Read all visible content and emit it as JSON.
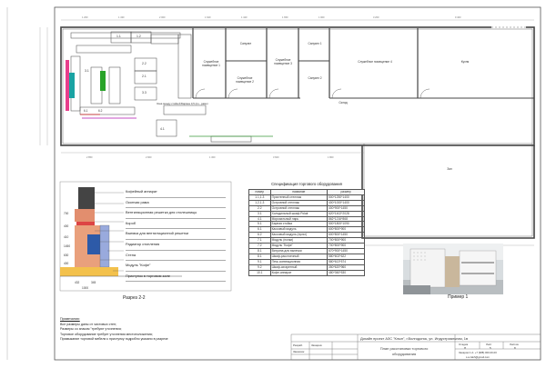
{
  "plan": {
    "rooms": [
      "Служебное помещение 1",
      "Санузел",
      "Служебное помещение 2",
      "Служебное помещение 3",
      "Санузел 1",
      "Санузел 2",
      "Служебное помещение 4",
      "Склад",
      "Кухня",
      "Зал"
    ],
    "labels": {
      "gap_note": "Зона между стойкой Бармен 0,5 (по - раме)",
      "stair": "4.1",
      "c11": "1.1",
      "c12": "1.2",
      "c22": "2.2",
      "c21": "2.1",
      "c33": "3.3",
      "c31": "3.1",
      "c61": "6.1",
      "c62": "6.2"
    }
  },
  "legend": {
    "items": [
      "Кофейный аппарат",
      "Окончая рама",
      "Вентиляционная решетка для столешницы",
      "Короб",
      "Выемка для вентиляционной решетки",
      "Радиатор отопления",
      "Стена",
      "Модуль \"Кофе\"",
      "Приступок в торговом зале"
    ],
    "dims": [
      "700",
      "400",
      "410",
      "1450",
      "630",
      "400",
      "432",
      "345",
      "1000"
    ]
  },
  "section_title": "Разрез 2-2",
  "spec": {
    "title": "Спецификация торгового оборудования",
    "headers": [
      "номер",
      "название",
      "размер"
    ],
    "rows": [
      [
        "1.1,1.3",
        "Пристенный стеллаж",
        "500*1250*1400"
      ],
      [
        "1.2,1.3",
        "Островной стеллаж",
        "400*1000*1400"
      ],
      [
        "2.2",
        "Островной стеллаж",
        "400*900*1450"
      ],
      [
        "3.1",
        "Холодильный шкаф Polair",
        "620*1402*2028"
      ],
      [
        "4.1",
        "Морозильный ларь",
        "862*1216*868"
      ],
      [
        "5.1",
        "Барная стойка",
        "500*1800*1090"
      ],
      [
        "6.1",
        "Кассовый модуль",
        "600*800*900"
      ],
      [
        "6.2",
        "Кассовый модуль (пульт)",
        "600*800*1450"
      ],
      [
        "7.1",
        "Модуль (полки)",
        "700*800*900"
      ],
      [
        "7.2",
        "Модуль \"Кофе\"",
        "700*800*900"
      ],
      [
        "8.1",
        "Витрина для выпечки",
        "670*900*1450"
      ],
      [
        "8.1",
        "Шкаф-расстоечный",
        "580*602*622"
      ],
      [
        "9.1",
        "Печь конвекционная",
        "580*613*574"
      ],
      [
        "9.2",
        "Шкаф-сигаретный",
        "350*620*960"
      ],
      [
        "10.1",
        "Кофе-аппарат",
        "480*360*530"
      ]
    ]
  },
  "photo_title": "Пример 1",
  "notes": {
    "title": "Примечания:",
    "lines": [
      "Все размеры даны от чистовых стен;",
      "Размеры со знаком \"требуют уточнения;",
      "Торговое оборудование требует уточнения местоположения;",
      "Примыкание торговой мебели к приступку подробно указано в разрезе"
    ]
  },
  "stamp": {
    "project": "Дизайн проект АЗС \"Клын\", г.Волгодонск, ул. Индустриальная, 1в",
    "sheet_name": "План расстановки торгового оборудования",
    "roles": [
      "Разраб.",
      "Заказчик"
    ],
    "names": [
      "Захаров"
    ],
    "cols": [
      "Стадия",
      "Лист",
      "Листов"
    ],
    "vals": [
      "П",
      "5",
      "8"
    ],
    "contact": "Захаров С.А. +7 (988) 000-00-00",
    "email": "s.a.zakh@gmail.com"
  }
}
